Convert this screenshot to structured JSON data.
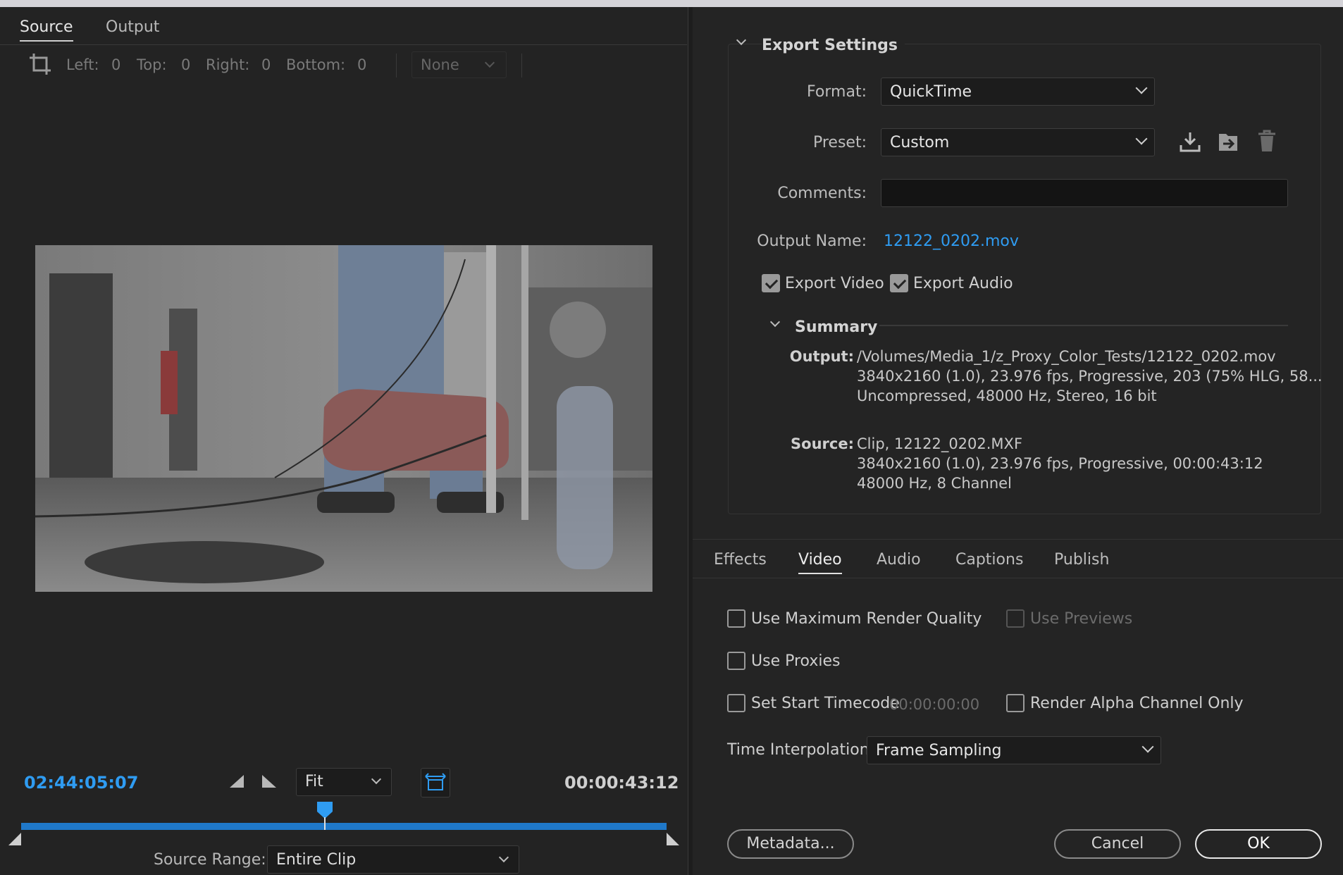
{
  "source_panel": {
    "tabs": [
      {
        "label": "Source"
      },
      {
        "label": "Output"
      }
    ],
    "crop": {
      "left_label": "Left:",
      "left_value": "0",
      "top_label": "Top:",
      "top_value": "0",
      "right_label": "Right:",
      "right_value": "0",
      "bottom_label": "Bottom:",
      "bottom_value": "0",
      "aspect_dropdown": "None"
    },
    "current_timecode": "02:44:05:07",
    "duration_timecode": "00:00:43:12",
    "zoom_dropdown": "Fit",
    "playhead_position": 0.47,
    "source_range_label": "Source Range:",
    "source_range_value": "Entire Clip"
  },
  "export_settings": {
    "title": "Export Settings",
    "format_label": "Format:",
    "format_value": "QuickTime",
    "preset_label": "Preset:",
    "preset_value": "Custom",
    "comments_label": "Comments:",
    "comments_value": "",
    "output_name_label": "Output Name:",
    "output_name_value": "12122_0202.mov",
    "export_video_label": "Export Video",
    "export_audio_label": "Export Audio",
    "summary": {
      "title": "Summary",
      "output_key": "Output:",
      "output_lines": [
        "/Volumes/Media_1/z_Proxy_Color_Tests/12122_0202.mov",
        "3840x2160 (1.0), 23.976 fps, Progressive, 203 (75% HLG, 58...",
        "Uncompressed, 48000 Hz, Stereo, 16 bit"
      ],
      "source_key": "Source:",
      "source_lines": [
        "Clip, 12122_0202.MXF",
        "3840x2160 (1.0), 23.976 fps, Progressive, 00:00:43:12",
        "48000 Hz, 8 Channel"
      ]
    }
  },
  "settings_tabs": [
    {
      "label": "Effects"
    },
    {
      "label": "Video"
    },
    {
      "label": "Audio"
    },
    {
      "label": "Captions"
    },
    {
      "label": "Publish"
    }
  ],
  "video_options": {
    "max_render_quality": "Use Maximum Render Quality",
    "use_previews": "Use Previews",
    "use_proxies": "Use Proxies",
    "set_start_timecode": "Set Start Timecode",
    "start_timecode_value": "00:00:00:00",
    "render_alpha": "Render Alpha Channel Only",
    "time_interpolation_label": "Time Interpolation:",
    "time_interpolation_value": "Frame Sampling"
  },
  "buttons": {
    "metadata": "Metadata...",
    "cancel": "Cancel",
    "ok": "OK"
  },
  "colors": {
    "accent_blue": "#2f9cf2",
    "timeline_blue": "#1f78c9",
    "panel_bg": "#232323"
  }
}
